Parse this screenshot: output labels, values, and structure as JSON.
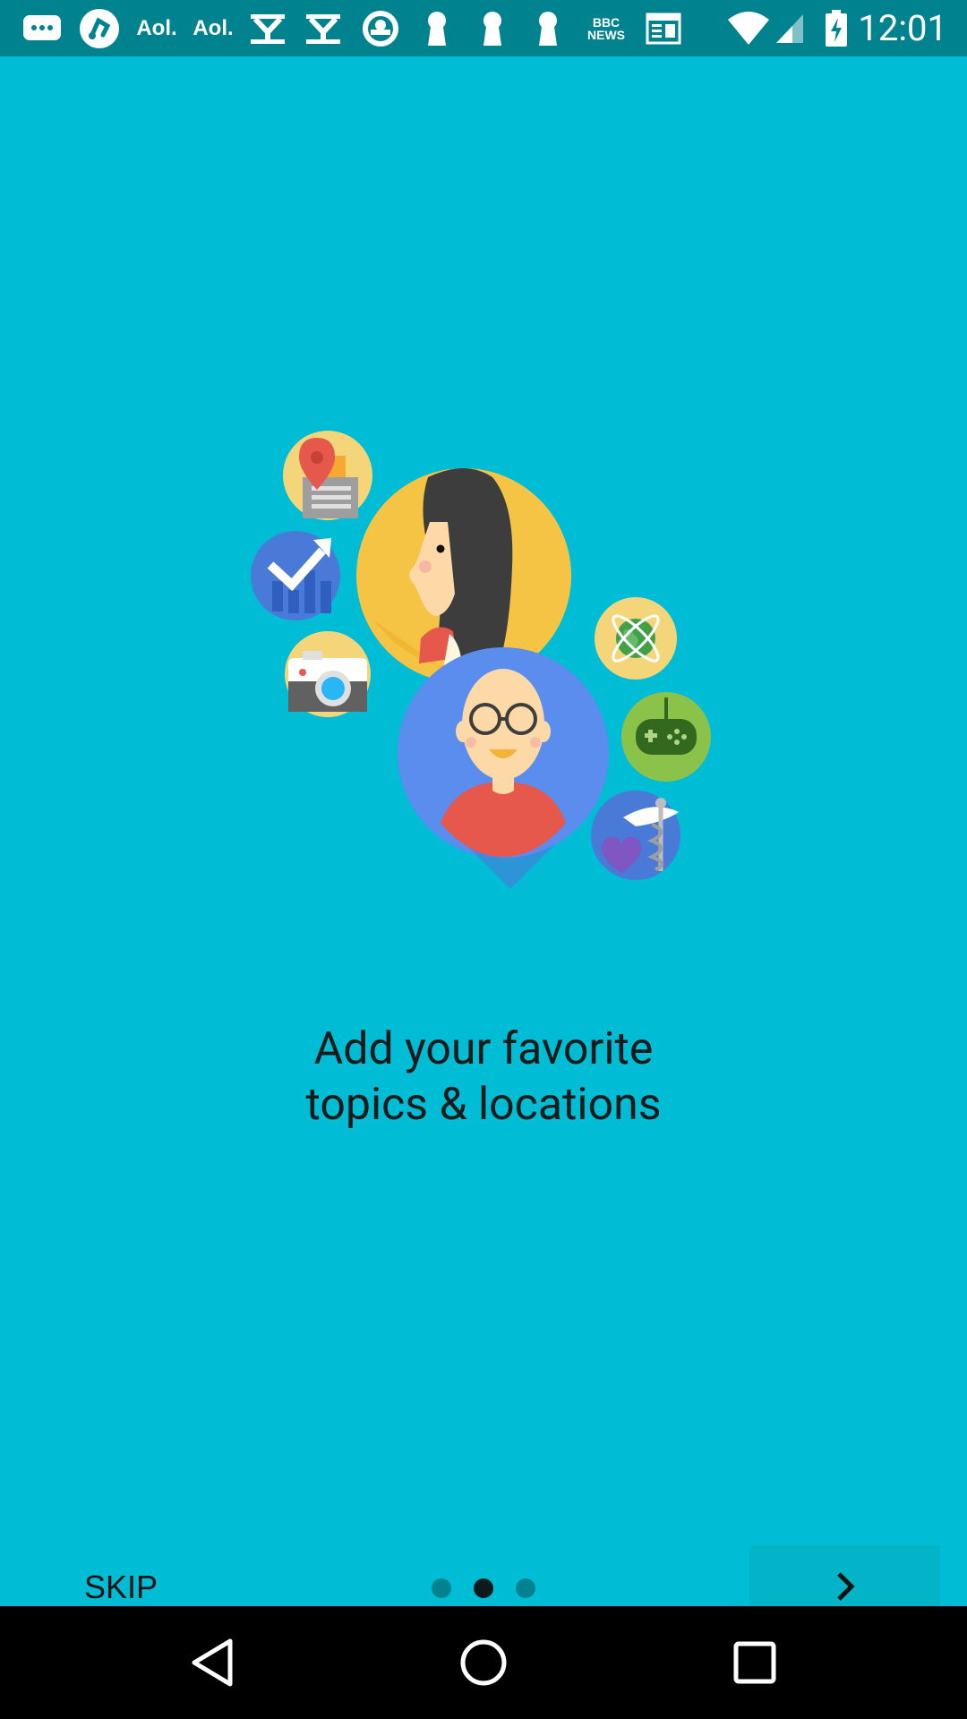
{
  "status_bar": {
    "time": "12:01",
    "notification_icons": [
      "chat-bubble-icon",
      "music-app-icon",
      "aol-icon",
      "aol-icon",
      "yahoo-icon",
      "yahoo-icon",
      "app-icon",
      "keyhole-icon",
      "keyhole-icon",
      "keyhole-icon",
      "bbc-news-icon",
      "news-reader-icon"
    ],
    "aol_label": "Aol.",
    "yahoo_label": "Y",
    "bbc_label_top": "BBC",
    "bbc_label_bottom": "NEWS",
    "system_icons": [
      "wifi-icon",
      "cell-signal-icon",
      "battery-charging-icon"
    ]
  },
  "onboarding": {
    "headline_line1": "Add your favorite",
    "headline_line2": "topics & locations",
    "skip_label": "SKIP",
    "page_count": 3,
    "current_page": 2,
    "next_icon": "chevron-right-icon"
  },
  "nav_bar": {
    "buttons": [
      "back-icon",
      "home-icon",
      "recents-icon"
    ]
  },
  "colors": {
    "background": "#00bcd4",
    "status_bar": "#00838f",
    "dot_inactive": "#00838f",
    "dot_active": "#0d1a1c"
  }
}
